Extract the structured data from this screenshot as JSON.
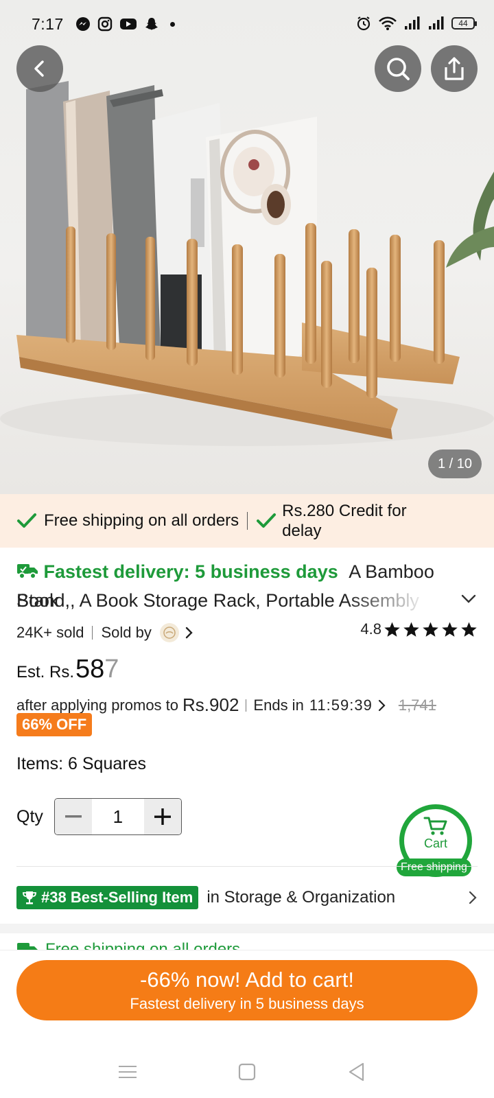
{
  "status_bar": {
    "time": "7:17",
    "battery": "44"
  },
  "gallery": {
    "counter": "1 / 10"
  },
  "promo_strip": {
    "free_shipping": "Free shipping on all orders",
    "credit_line1": "Rs.280 Credit for",
    "credit_line2": "delay"
  },
  "product": {
    "fast_delivery": "Fastest delivery: 5 business days",
    "title_line1": "A Bamboo Book",
    "title_line2": "Stand,, A Book Storage Rack, Portable Assembly",
    "sold": "24K+ sold",
    "sold_by": "Sold by",
    "rating": "4.8"
  },
  "price": {
    "est_label": "Est. Rs.",
    "est_main": "58",
    "est_faded": "7",
    "promo_prefix": "after applying promos to",
    "promo_amount": "Rs.902",
    "ends_label": "Ends in",
    "countdown": "11:59:39",
    "original": "1,741",
    "discount_badge": "66% OFF"
  },
  "options": {
    "items_label": "Items:",
    "items_value": "6 Squares"
  },
  "quantity": {
    "label": "Qty",
    "value": "1"
  },
  "cart_float": {
    "label": "Cart",
    "badge": "Free shipping"
  },
  "best_seller": {
    "badge": "#38 Best-Selling Item",
    "category": "in Storage & Organization"
  },
  "peek": {
    "text": "Free shipping on all orders"
  },
  "cta": {
    "line1": "-66% now! Add to cart!",
    "line2": "Fastest delivery in 5 business days"
  },
  "colors": {
    "accent_orange": "#f57c16",
    "accent_green": "#1e9a3a",
    "promo_bg": "#fdeee2"
  },
  "icons": [
    "messenger-icon",
    "instagram-icon",
    "youtube-icon",
    "snapchat-icon",
    "alarm-icon",
    "wifi-icon",
    "signal-icon",
    "battery-icon",
    "back-icon",
    "search-icon",
    "share-icon",
    "check-icon",
    "truck-icon",
    "star-icon",
    "chevron-right-icon",
    "chevron-down-icon",
    "cart-icon",
    "trophy-icon",
    "minus-icon",
    "plus-icon",
    "menu-icon",
    "home-icon",
    "back-triangle-icon"
  ]
}
